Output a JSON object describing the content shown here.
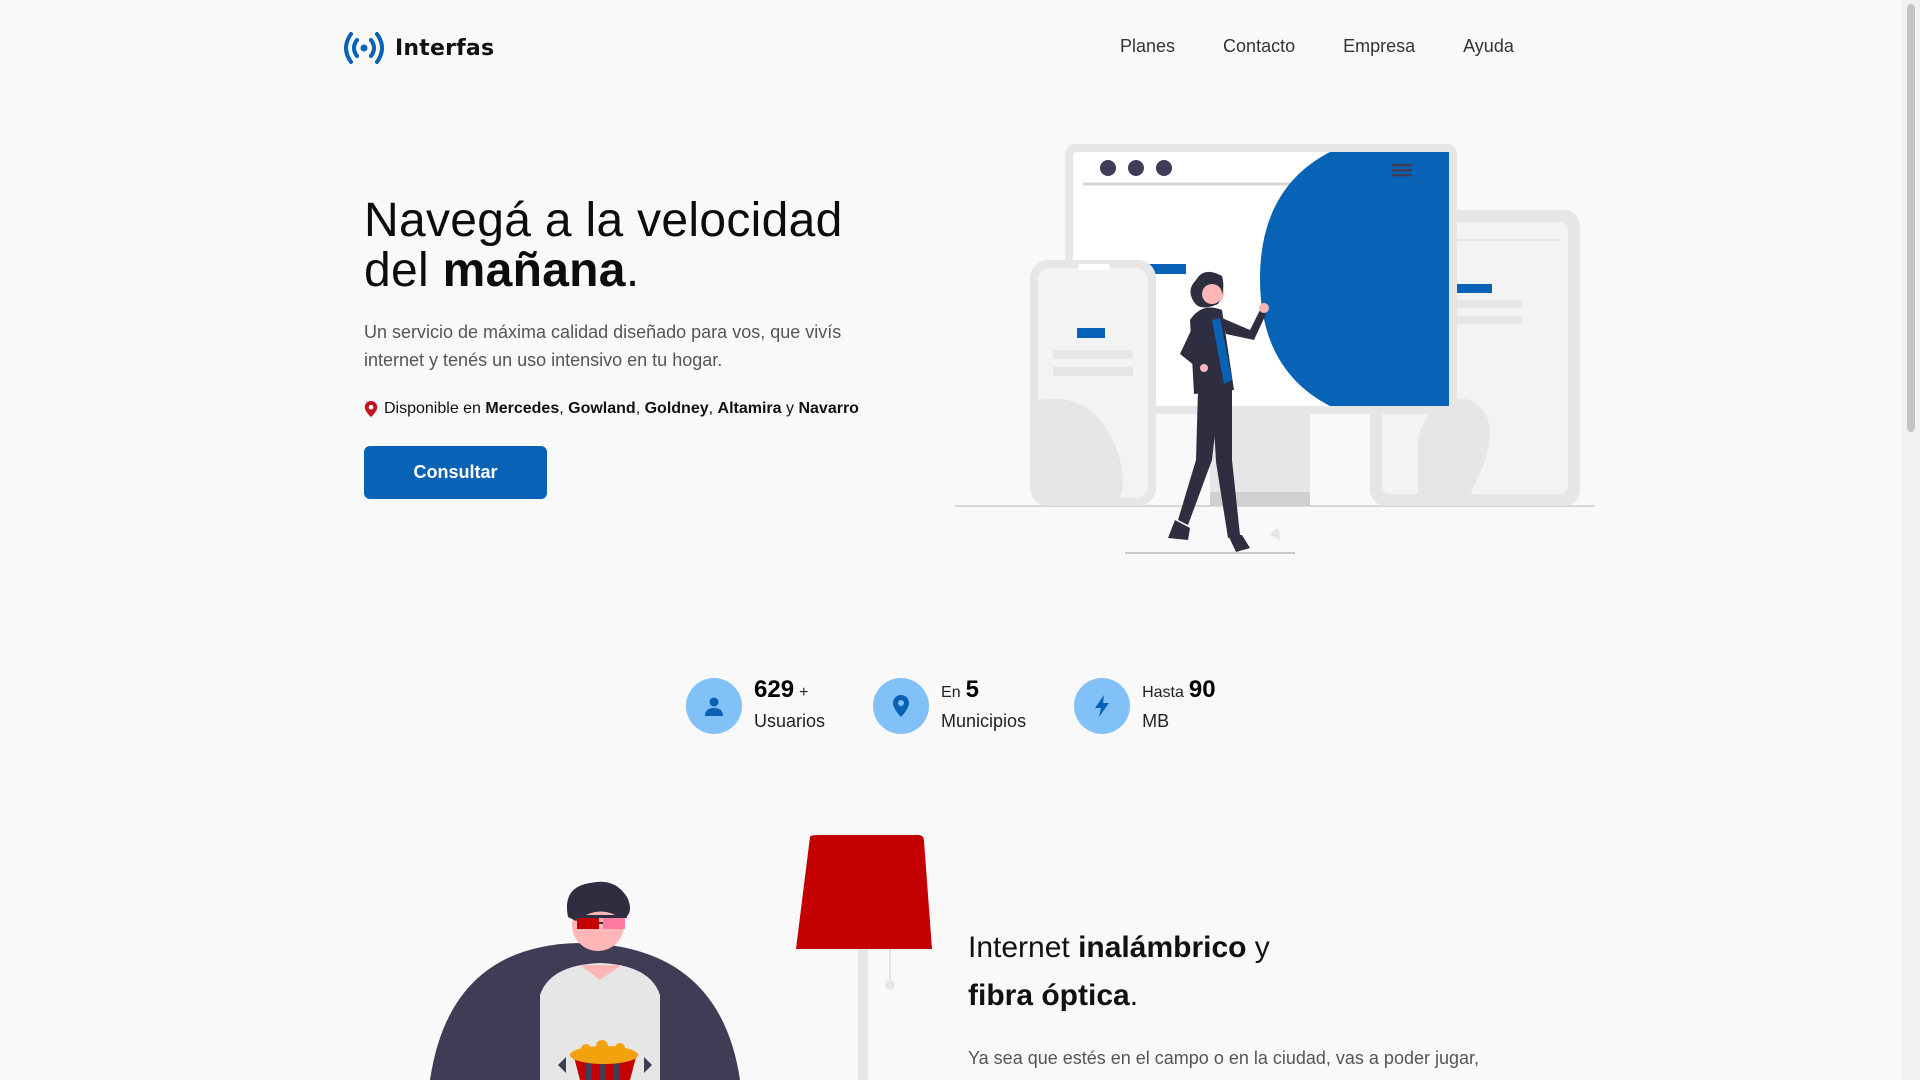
{
  "brand": {
    "name": "Interfas",
    "color": "#0862b5"
  },
  "nav": {
    "items": [
      "Planes",
      "Contacto",
      "Empresa",
      "Ayuda"
    ]
  },
  "hero": {
    "title_line1": "Navegá a la velocidad",
    "title_line2_prefix": "del ",
    "title_line2_bold": "mañana",
    "title_line2_suffix": ".",
    "description": "Un servicio de máxima calidad diseñado para vos, que vivís internet y tenés un uso intensivo en tu hogar.",
    "availability": {
      "prefix": "Disponible en",
      "places": [
        "Mercedes",
        "Gowland",
        "Goldney",
        "Altamira",
        "Navarro"
      ],
      "sep": ",",
      "and": "y"
    },
    "cta_label": "Consultar"
  },
  "stats": [
    {
      "icon": "user-icon",
      "value": "629",
      "value_suffix": "+",
      "label": "Usuarios"
    },
    {
      "icon": "map-pin-icon",
      "prefix": "En",
      "value": "5",
      "label": "Municipios"
    },
    {
      "icon": "lightning-icon",
      "prefix": "Hasta",
      "value": "90",
      "label": "MB"
    }
  ],
  "section2": {
    "title_prefix": "Internet ",
    "title_bold1": "inalámbrico",
    "title_mid": " y",
    "title_bold2": "fibra óptica",
    "title_suffix": ".",
    "description": "Ya sea que estés en el campo o en la ciudad, vas a poder jugar,"
  },
  "colors": {
    "primary": "#0862b5",
    "stat_circle": "#81c1f7",
    "pin": "#c0151c",
    "lamp": "#c40000",
    "dark": "#2f2e41"
  }
}
